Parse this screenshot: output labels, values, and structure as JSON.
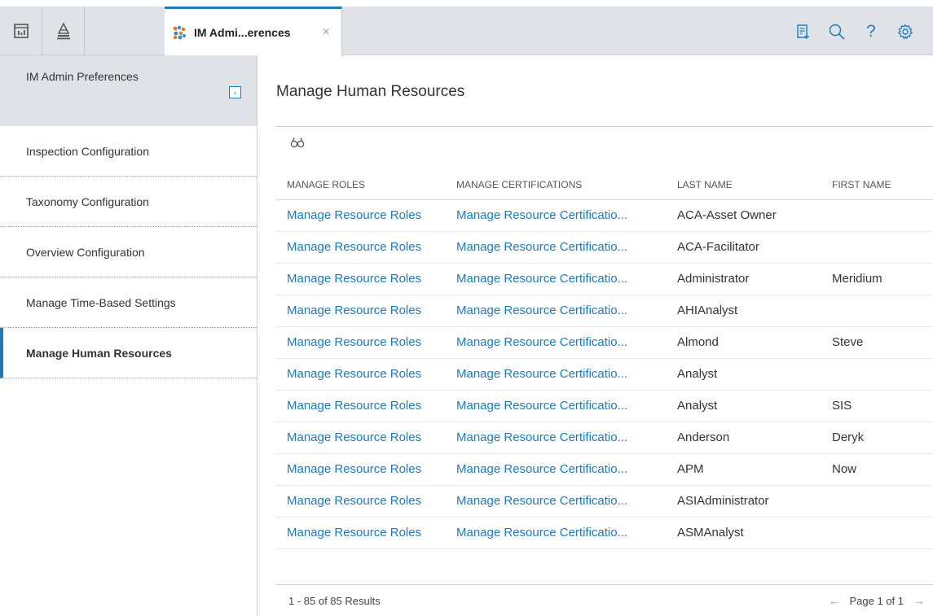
{
  "tab": {
    "title": "IM Admi...erences",
    "close": "×"
  },
  "toolbar_icons": [
    "dashboard-icon",
    "asset-hierarchy-icon",
    "new-record-icon",
    "search-icon",
    "help-icon",
    "settings-icon"
  ],
  "toolbar": {
    "help_glyph": "?"
  },
  "colors": {
    "accent": "#1f7ab8",
    "chrome": "#dfe3e8",
    "link": "#1f7ab8"
  },
  "sidebar": {
    "title": "IM Admin Preferences",
    "collapse_glyph": "‹",
    "items": [
      {
        "label": "Inspection Configuration"
      },
      {
        "label": "Taxonomy Configuration"
      },
      {
        "label": "Overview Configuration"
      },
      {
        "label": "Manage Time-Based Settings"
      },
      {
        "label": "Manage Human Resources",
        "active": true
      }
    ]
  },
  "main": {
    "title": "Manage Human Resources",
    "columns": [
      "MANAGE ROLES",
      "MANAGE CERTIFICATIONS",
      "LAST NAME",
      "FIRST NAME"
    ],
    "rows": [
      {
        "roles": "Manage Resource Roles",
        "certs": "Manage Resource Certificatio...",
        "last": "ACA-Asset Owner",
        "first": ""
      },
      {
        "roles": "Manage Resource Roles",
        "certs": "Manage Resource Certificatio...",
        "last": "ACA-Facilitator",
        "first": ""
      },
      {
        "roles": "Manage Resource Roles",
        "certs": "Manage Resource Certificatio...",
        "last": "Administrator",
        "first": "Meridium"
      },
      {
        "roles": "Manage Resource Roles",
        "certs": "Manage Resource Certificatio...",
        "last": "AHIAnalyst",
        "first": ""
      },
      {
        "roles": "Manage Resource Roles",
        "certs": "Manage Resource Certificatio...",
        "last": "Almond",
        "first": "Steve"
      },
      {
        "roles": "Manage Resource Roles",
        "certs": "Manage Resource Certificatio...",
        "last": "Analyst",
        "first": ""
      },
      {
        "roles": "Manage Resource Roles",
        "certs": "Manage Resource Certificatio...",
        "last": "Analyst",
        "first": "SIS"
      },
      {
        "roles": "Manage Resource Roles",
        "certs": "Manage Resource Certificatio...",
        "last": "Anderson",
        "first": "Deryk"
      },
      {
        "roles": "Manage Resource Roles",
        "certs": "Manage Resource Certificatio...",
        "last": "APM",
        "first": "Now"
      },
      {
        "roles": "Manage Resource Roles",
        "certs": "Manage Resource Certificatio...",
        "last": "ASIAdministrator",
        "first": ""
      },
      {
        "roles": "Manage Resource Roles",
        "certs": "Manage Resource Certificatio...",
        "last": "ASMAnalyst",
        "first": ""
      }
    ],
    "footer": {
      "results": "1 - 85 of 85 Results",
      "page": "Page 1 of 1",
      "prev_glyph": "←",
      "next_glyph": "→"
    }
  }
}
